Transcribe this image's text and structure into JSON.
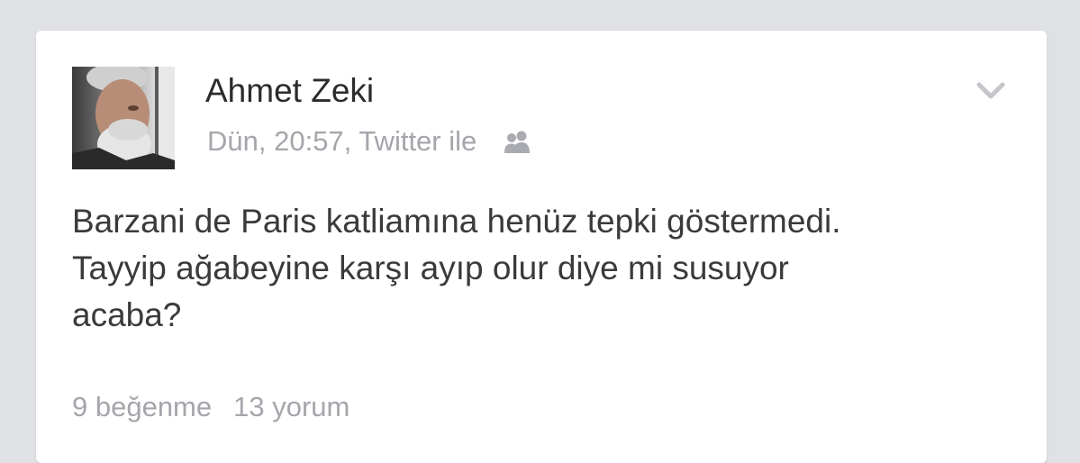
{
  "post": {
    "author": "Ahmet Zeki",
    "meta": "Dün, 20:57, Twitter ile",
    "text_lines": [
      "Barzani de Paris katliamına henüz tepki göstermedi.",
      "Tayyip ağabeyine karşı ayıp olur diye mi susuyor",
      "acaba?"
    ],
    "likes": "9 beğenme",
    "comments": "13 yorum"
  },
  "icons": {
    "audience": "friends-icon",
    "menu": "chevron-down-icon"
  },
  "colors": {
    "background": "#dfe1e5",
    "card": "#ffffff",
    "name_text": "#2b2b2b",
    "body_text": "#3a3a3a",
    "muted_text": "#a4a6ab"
  }
}
